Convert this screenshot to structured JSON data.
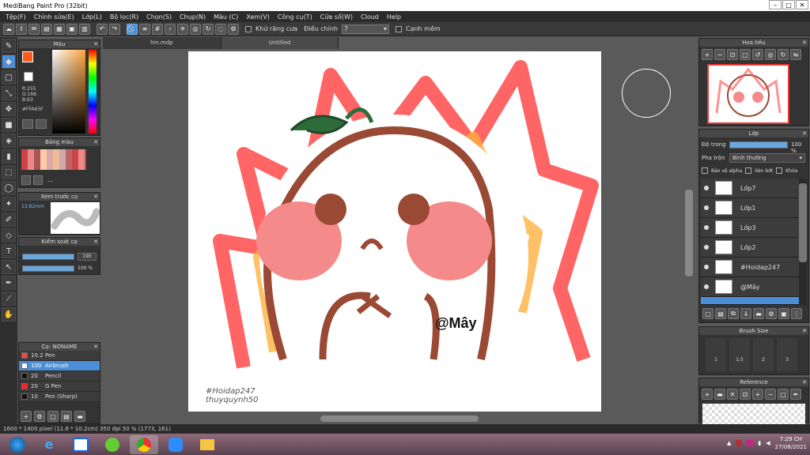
{
  "title": "MediBang Paint Pro (32bit)",
  "window_buttons": [
    "–",
    "□",
    "✕"
  ],
  "menu": [
    "Tệp(F)",
    "Chỉnh sửa(E)",
    "Lớp(L)",
    "Bộ lọc(R)",
    "Chọn(S)",
    "Chụp(N)",
    "Màu (C)",
    "Xem(V)",
    "Công cụ(T)",
    "Cửa sổ(W)",
    "Cloud",
    "Help"
  ],
  "toolbar": {
    "antialias_label": "Khử răng cưa",
    "adjust_label": "Điều chỉnh",
    "adjust_value": "7",
    "edge_label": "Cạnh mềm"
  },
  "tabs": [
    "hin.mdp",
    "Untitled"
  ],
  "color_panel": {
    "title": "Màu",
    "r": "R:255",
    "g": "G:166",
    "b": "B:63",
    "hex": "#FFA63F",
    "primary": "#ff5a1e",
    "secondary": "#ffffff"
  },
  "palette_panel": {
    "title": "Bảng màu",
    "more": "..."
  },
  "preview_panel": {
    "title": "Xem trước cọ",
    "size": "13.82mm"
  },
  "brush_control": {
    "title": "Kiểm soát cọ",
    "size_value": "190",
    "opacity_value": "100 %",
    "size_fill": 1.0,
    "opacity_fill": 1.0
  },
  "brush_list": {
    "title": "Cọ: NONAME",
    "items": [
      {
        "size": "10.2",
        "name": "Pen",
        "color": "#ff4444"
      },
      {
        "size": "100",
        "name": "Airbrush",
        "color": "#ffffff"
      },
      {
        "size": "20",
        "name": "Pencil",
        "color": "#111111"
      },
      {
        "size": "20",
        "name": "G Pen",
        "color": "#ff2222"
      },
      {
        "size": "10",
        "name": "Pen (Sharp)",
        "color": "#111111"
      }
    ]
  },
  "navigator": {
    "title": "Hoa tiêu"
  },
  "layer_panel": {
    "title": "Lớp",
    "opacity_label": "Độ trong",
    "opacity_value": "100 %",
    "opacity_fill": 1.0,
    "blend_label": "Pha trộn",
    "blend_value": "Bình thường",
    "protect_alpha": "Bảo vệ alpha",
    "clip": "Xén bớt",
    "lock": "Khóa",
    "layers": [
      {
        "name": "Lớp7"
      },
      {
        "name": "Lớp1"
      },
      {
        "name": "Lớp3"
      },
      {
        "name": "Lớp2"
      },
      {
        "name": "#Hoidap247"
      },
      {
        "name": "@Mây"
      }
    ]
  },
  "brush_size_panel": {
    "title": "Brush Size",
    "sizes": [
      "1",
      "1.5",
      "2",
      "3"
    ]
  },
  "reference_panel": {
    "title": "Reference"
  },
  "artwork": {
    "signature": "@Mây",
    "watermark1": "#Hoidap247",
    "watermark2": "thuyquynh50"
  },
  "status": "1600 * 1400 pixel  (11.6 * 10.2cm)  350 dpi  50 %  (1773, 161)",
  "clock": {
    "time": "7:29 CH",
    "date": "27/08/2021"
  }
}
